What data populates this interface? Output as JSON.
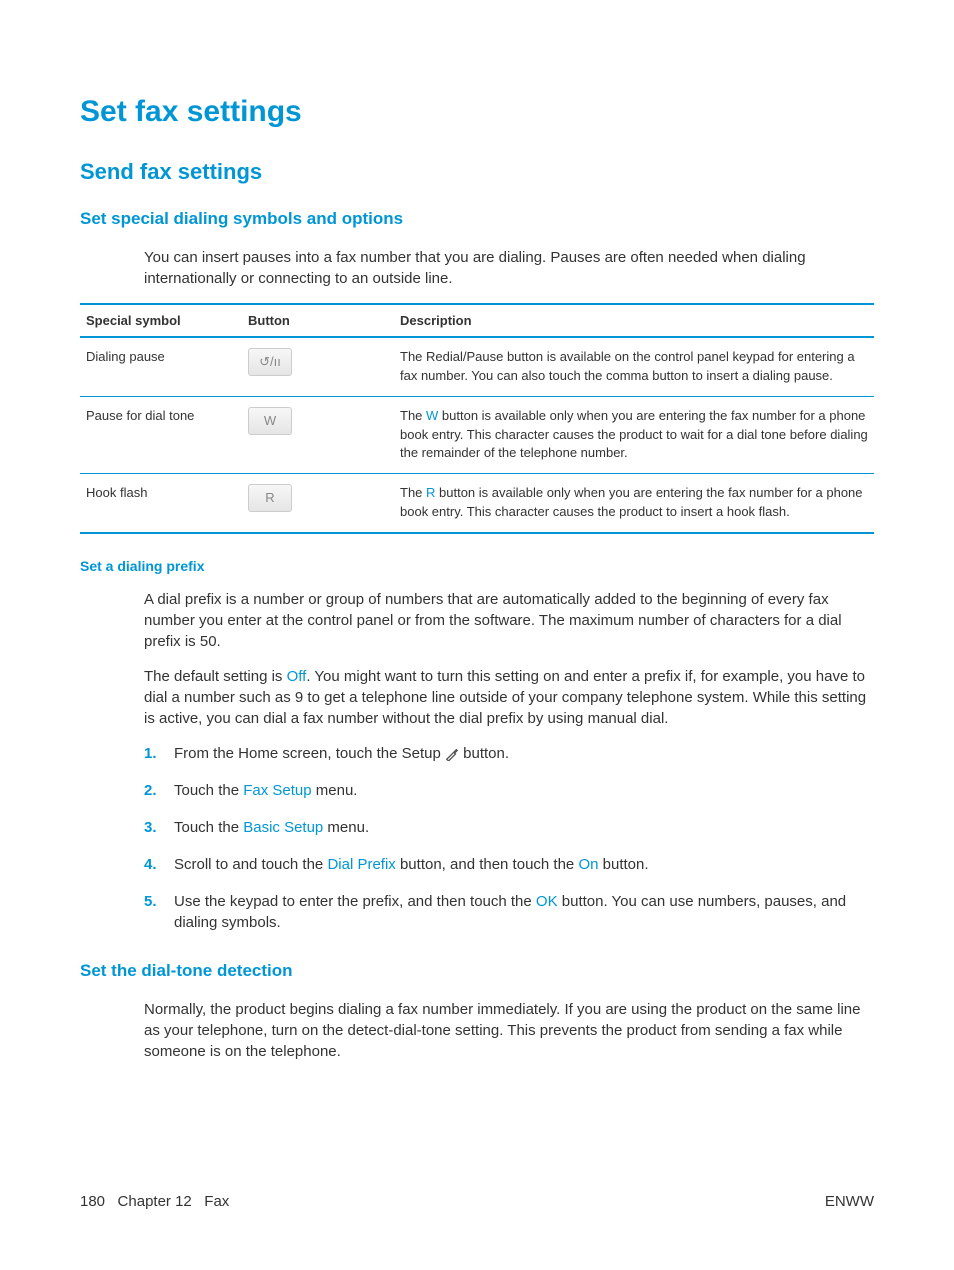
{
  "title": "Set fax settings",
  "sections": {
    "send": {
      "heading": "Send fax settings",
      "sub1": {
        "heading": "Set special dialing symbols and options",
        "intro": "You can insert pauses into a fax number that you are dialing. Pauses are often needed when dialing internationally or connecting to an outside line.",
        "table": {
          "headers": {
            "symbol": "Special symbol",
            "button": "Button",
            "desc": "Description"
          },
          "rows": [
            {
              "symbol": "Dialing pause",
              "button_glyph": "↺/ıı",
              "desc": "The Redial/Pause button is available on the control panel keypad for entering a fax number. You can also touch the comma button to insert a dialing pause."
            },
            {
              "symbol": "Pause for dial tone",
              "button_glyph": "W",
              "desc_prefix": "The ",
              "desc_link": "W",
              "desc_suffix": " button is available only when you are entering the fax number for a phone book entry. This character causes the product to wait for a dial tone before dialing the remainder of the telephone number."
            },
            {
              "symbol": "Hook flash",
              "button_glyph": "R",
              "desc_prefix": "The ",
              "desc_link": "R",
              "desc_suffix": " button is available only when you are entering the fax number for a phone book entry. This character causes the product to insert a hook flash."
            }
          ]
        }
      },
      "sub2": {
        "heading": "Set a dialing prefix",
        "p1": "A dial prefix is a number or group of numbers that are automatically added to the beginning of every fax number you enter at the control panel or from the software. The maximum number of characters for a dial prefix is 50.",
        "p2_a": "The default setting is ",
        "p2_link": "Off",
        "p2_b": ". You might want to turn this setting on and enter a prefix if, for example, you have to dial a number such as 9 to get a telephone line outside of your company telephone system. While this setting is active, you can dial a fax number without the dial prefix by using manual dial.",
        "steps": [
          {
            "num": "1.",
            "a": "From the Home screen, touch the Setup ",
            "b": " button."
          },
          {
            "num": "2.",
            "a": "Touch the ",
            "link": "Fax Setup",
            "b": " menu."
          },
          {
            "num": "3.",
            "a": "Touch the ",
            "link": "Basic Setup",
            "b": " menu."
          },
          {
            "num": "4.",
            "a": "Scroll to and touch the ",
            "link": "Dial Prefix",
            "b": " button, and then touch the ",
            "link2": "On",
            "c": " button."
          },
          {
            "num": "5.",
            "a": "Use the keypad to enter the prefix, and then touch the ",
            "link": "OK",
            "b": " button. You can use numbers, pauses, and dialing symbols."
          }
        ]
      },
      "sub3": {
        "heading": "Set the dial-tone detection",
        "p1": "Normally, the product begins dialing a fax number immediately. If you are using the product on the same line as your telephone, turn on the detect-dial-tone setting. This prevents the product from sending a fax while someone is on the telephone."
      }
    }
  },
  "footer": {
    "page": "180",
    "chapter_label": "Chapter 12",
    "chapter_title": "Fax",
    "right": "ENWW"
  }
}
